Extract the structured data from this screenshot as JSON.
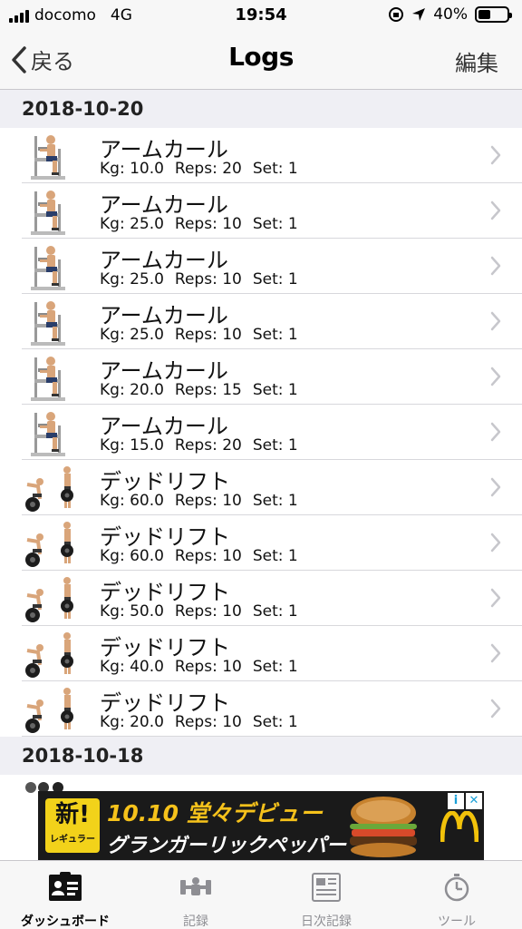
{
  "status_bar": {
    "carrier": "docomo",
    "network": "4G",
    "time": "19:54",
    "battery": "40%"
  },
  "nav": {
    "back_label": "戻る",
    "title": "Logs",
    "edit_label": "編集"
  },
  "sections": [
    {
      "date": "2018-10-20",
      "entries": [
        {
          "exercise": "アームカール",
          "icon": "arm-curl-machine-icon",
          "kg": "Kg: 10.0",
          "reps": "Reps: 20",
          "set": "Set: 1"
        },
        {
          "exercise": "アームカール",
          "icon": "arm-curl-machine-icon",
          "kg": "Kg: 25.0",
          "reps": "Reps: 10",
          "set": "Set: 1"
        },
        {
          "exercise": "アームカール",
          "icon": "arm-curl-machine-icon",
          "kg": "Kg: 25.0",
          "reps": "Reps: 10",
          "set": "Set: 1"
        },
        {
          "exercise": "アームカール",
          "icon": "arm-curl-machine-icon",
          "kg": "Kg: 25.0",
          "reps": "Reps: 10",
          "set": "Set: 1"
        },
        {
          "exercise": "アームカール",
          "icon": "arm-curl-machine-icon",
          "kg": "Kg: 20.0",
          "reps": "Reps: 15",
          "set": "Set: 1"
        },
        {
          "exercise": "アームカール",
          "icon": "arm-curl-machine-icon",
          "kg": "Kg: 15.0",
          "reps": "Reps: 20",
          "set": "Set: 1"
        },
        {
          "exercise": "デッドリフト",
          "icon": "deadlift-icon",
          "kg": "Kg: 60.0",
          "reps": "Reps: 10",
          "set": "Set: 1"
        },
        {
          "exercise": "デッドリフト",
          "icon": "deadlift-icon",
          "kg": "Kg: 60.0",
          "reps": "Reps: 10",
          "set": "Set: 1"
        },
        {
          "exercise": "デッドリフト",
          "icon": "deadlift-icon",
          "kg": "Kg: 50.0",
          "reps": "Reps: 10",
          "set": "Set: 1"
        },
        {
          "exercise": "デッドリフト",
          "icon": "deadlift-icon",
          "kg": "Kg: 40.0",
          "reps": "Reps: 10",
          "set": "Set: 1"
        },
        {
          "exercise": "デッドリフト",
          "icon": "deadlift-icon",
          "kg": "Kg: 20.0",
          "reps": "Reps: 10",
          "set": "Set: 1"
        }
      ]
    },
    {
      "date": "2018-10-18",
      "entries": []
    }
  ],
  "ad": {
    "badge": "新!",
    "badge_sub": "レギュラー",
    "headline": "10.10 堂々デビュー",
    "sub": "グランガーリックペッパー",
    "adchoice_info": "i",
    "adchoice_close": "✕"
  },
  "tabs": [
    {
      "label": "ダッシュボード",
      "icon": "dashboard-icon",
      "active": true
    },
    {
      "label": "記録",
      "icon": "dumbbell-icon",
      "active": false
    },
    {
      "label": "日次記録",
      "icon": "daily-log-icon",
      "active": false
    },
    {
      "label": "ツール",
      "icon": "stopwatch-icon",
      "active": false
    }
  ],
  "colors": {
    "bar_bg": "#f7f7f7",
    "section_bg": "#efeff4",
    "tab_inactive": "#8e8e93",
    "chevron": "#c7c7cc",
    "ad_yellow": "#f6c21b"
  }
}
